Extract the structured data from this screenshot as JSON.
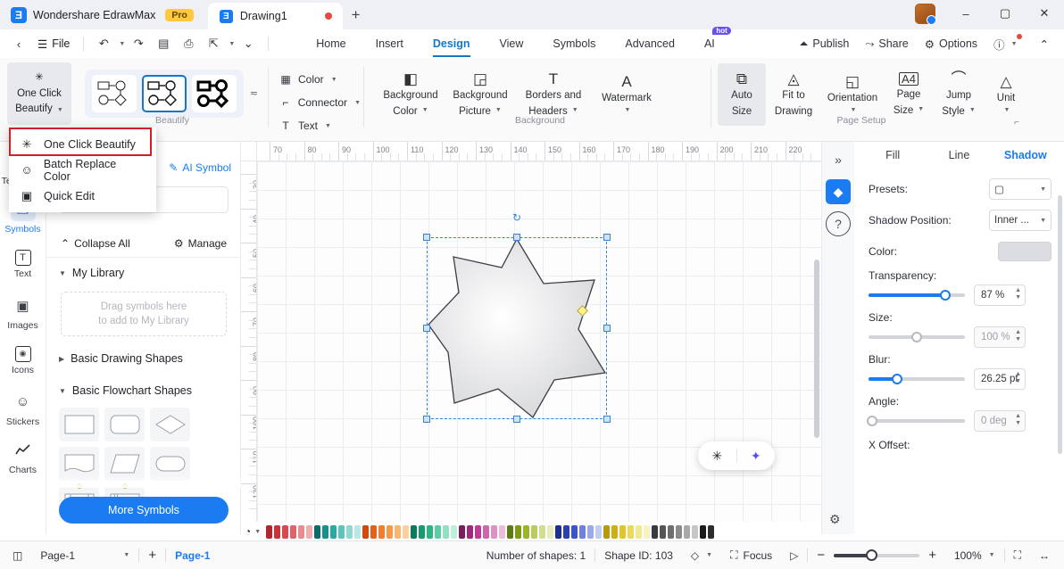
{
  "titlebar": {
    "brand": "Wondershare EdrawMax",
    "pro_badge": "Pro",
    "logo_glyph": "Ǝ",
    "doc_tab": "Drawing1",
    "new_tab_glyph": "+",
    "minimize": "–",
    "maximize": "▢",
    "close": "✕"
  },
  "menubar": {
    "back_glyph": "‹",
    "file": "File",
    "undo_glyph": "↶",
    "redo_glyph": "↷",
    "save_glyph": "▤",
    "print_glyph": "⎙",
    "export_glyph": "⇱",
    "more_glyph": "⌄",
    "tabs": [
      {
        "label": "Home",
        "active": false
      },
      {
        "label": "Insert",
        "active": false
      },
      {
        "label": "Design",
        "active": true
      },
      {
        "label": "View",
        "active": false
      },
      {
        "label": "Symbols",
        "active": false
      },
      {
        "label": "Advanced",
        "active": false
      },
      {
        "label": "AI",
        "active": false,
        "badge": "hot"
      }
    ],
    "right": [
      {
        "label": "Publish",
        "icon": "⏶"
      },
      {
        "label": "Share",
        "icon": "⤳"
      },
      {
        "label": "Options",
        "icon": "⚙"
      }
    ],
    "help_glyph": "?",
    "collapse_glyph": "⌃"
  },
  "ribbon": {
    "one_click_beautify": {
      "line1": "One Click",
      "line2": "Beautify"
    },
    "beautify_group_label": "Beautify",
    "style_cards": [
      "thin-flowchart-style",
      "medium-flowchart-style",
      "bold-flowchart-style"
    ],
    "selected_style_index": 1,
    "small_items": [
      {
        "label": "Color",
        "icon": "▦"
      },
      {
        "label": "Connector",
        "icon": "⌐"
      },
      {
        "label": "Text",
        "icon": "T"
      }
    ],
    "background_group": {
      "label": "Background",
      "buttons": [
        {
          "line1": "Background",
          "line2": "Color",
          "icon": "◧"
        },
        {
          "line1": "Background",
          "line2": "Picture",
          "icon": "◲"
        },
        {
          "line1": "Borders and",
          "line2": "Headers",
          "icon": "T"
        },
        {
          "line1": "Watermark",
          "line2": "",
          "icon": "A"
        }
      ]
    },
    "page_setup_group": {
      "label": "Page Setup",
      "buttons": [
        {
          "line1": "Auto",
          "line2": "Size",
          "icon": "⧉",
          "selected": true
        },
        {
          "line1": "Fit to",
          "line2": "Drawing",
          "icon": "◬",
          "selected": false
        },
        {
          "line1": "Orientation",
          "line2": "",
          "icon": "◱",
          "selected": false
        },
        {
          "line1": "Page",
          "line2": "Size",
          "icon": "A4",
          "selected": false
        },
        {
          "line1": "Jump",
          "line2": "Style",
          "icon": "⌒",
          "selected": false
        },
        {
          "line1": "Unit",
          "line2": "",
          "icon": "△",
          "selected": false
        }
      ],
      "dialog_launcher": "⌐"
    }
  },
  "dropdown_menu": {
    "items": [
      {
        "label": "One Click Beautify",
        "icon": "✳",
        "highlighted": true
      },
      {
        "label": "Batch Replace Color",
        "icon": "☺"
      },
      {
        "label": "Quick Edit",
        "icon": "▣"
      }
    ],
    "highlight_color": "#cf2027"
  },
  "left_rail": {
    "items": [
      {
        "label": "Templates",
        "icon": "▤",
        "active": false
      },
      {
        "label": "Symbols",
        "icon": "❐",
        "active": true
      },
      {
        "label": "Text",
        "icon": "T",
        "active": false
      },
      {
        "label": "Images",
        "icon": "▣",
        "active": false
      },
      {
        "label": "Icons",
        "icon": "◉",
        "active": false
      },
      {
        "label": "Stickers",
        "icon": "☺",
        "active": false
      },
      {
        "label": "Charts",
        "icon": "📈",
        "active": false
      }
    ]
  },
  "symbols_panel": {
    "ai_symbol": "AI Symbol",
    "ai_symbol_icon": "✎",
    "search_placeholder": "Search symbols",
    "collapse_all": "Collapse All",
    "collapse_icon": "⌃",
    "manage": "Manage",
    "manage_icon": "⚙",
    "sections": [
      {
        "title": "My Library",
        "expanded": true
      },
      {
        "title": "Basic Drawing Shapes",
        "expanded": false
      },
      {
        "title": "Basic Flowchart Shapes",
        "expanded": true
      }
    ],
    "drop_hint_line1": "Drag symbols here",
    "drop_hint_line2": "to add to My Library",
    "more_symbols": "More Symbols"
  },
  "canvas": {
    "h_ruler_labels": [
      70,
      80,
      90,
      100,
      110,
      120,
      130,
      140,
      150,
      160,
      170,
      180,
      190,
      200,
      210,
      220
    ],
    "v_ruler_labels": [
      30,
      40,
      50,
      60,
      70,
      80,
      90,
      100,
      110,
      120
    ],
    "shape": {
      "name": "7-point-star",
      "points": 7
    },
    "rotate_handle_glyph": "↻",
    "float_buttons": [
      {
        "name": "beautify-float-button",
        "glyph": "✳"
      },
      {
        "name": "ai-float-button",
        "glyph": "✦"
      }
    ]
  },
  "palette": {
    "fill_icon": "◔",
    "colors": [
      "#b3262c",
      "#c9343a",
      "#d9484e",
      "#e06369",
      "#e98b8f",
      "#f0aeb1",
      "#0e6b6b",
      "#17908c",
      "#2aa8a2",
      "#5cc3bd",
      "#8fd8d4",
      "#b9e7e4",
      "#d3480f",
      "#e2621c",
      "#ef7f2c",
      "#f49a4a",
      "#f8b673",
      "#fbcf9f",
      "#0f7a5a",
      "#189a6e",
      "#2bb583",
      "#5ccda3",
      "#92e0c4",
      "#c0eedd",
      "#7a1f5e",
      "#a0297a",
      "#bc3d93",
      "#cc67ab",
      "#dc93c4",
      "#ebbddb",
      "#5e7a12",
      "#7d9a19",
      "#9bb52b",
      "#b8cd5c",
      "#d1de92",
      "#e6edc0",
      "#1e2f8e",
      "#2b41ad",
      "#3b56c9",
      "#6d82dc",
      "#9aa9e8",
      "#c3cdf2",
      "#b59a0c",
      "#cdb018",
      "#e0c62b",
      "#ead95c",
      "#f2e892",
      "#f8f2c0",
      "#3b3b3b",
      "#555555",
      "#6e6e6e",
      "#8a8a8a",
      "#a8a8a8",
      "#c6c6c6",
      "#1b1b1b",
      "#2e2e2e"
    ]
  },
  "right_panel": {
    "rail_icons": [
      {
        "name": "collapse-panel-icon",
        "glyph": "»"
      },
      {
        "name": "fill-bucket-icon",
        "glyph": "◆",
        "active": true
      },
      {
        "name": "help-icon",
        "glyph": "?"
      }
    ],
    "tabs": [
      {
        "label": "Fill",
        "active": false
      },
      {
        "label": "Line",
        "active": false
      },
      {
        "label": "Shadow",
        "active": true
      }
    ],
    "fields": [
      {
        "label": "Presets:",
        "type": "select",
        "value": "▢"
      },
      {
        "label": "Shadow Position:",
        "type": "select",
        "value": "Inner ..."
      },
      {
        "label": "Color:",
        "type": "swatch",
        "value": "#dcdde0"
      }
    ],
    "sliders": [
      {
        "label": "Transparency:",
        "value": "87 %",
        "fill_pct": 80,
        "active": true
      },
      {
        "label": "Size:",
        "value": "100 %",
        "fill_pct": 0,
        "active": false
      },
      {
        "label": "Blur:",
        "value": "26.25 pt",
        "fill_pct": 30,
        "active": true
      },
      {
        "label": "Angle:",
        "value": "0 deg",
        "fill_pct": 0,
        "active": false
      }
    ],
    "next_label": "X Offset:",
    "settings_icon": "⚙"
  },
  "statusbar": {
    "page_view_icon": "◫",
    "page_select": "Page-1",
    "add_page": "+",
    "page_tab": "Page-1",
    "shape_count": "Number of shapes: 1",
    "shape_id": "Shape ID: 103",
    "layers_icon": "◇",
    "focus_label": "Focus",
    "focus_icon": "⛶",
    "present_icon": "▷",
    "zoom_out": "−",
    "zoom_in": "+",
    "zoom_level": "100%",
    "fit_icon": "⛶",
    "width_icon": "↔"
  }
}
